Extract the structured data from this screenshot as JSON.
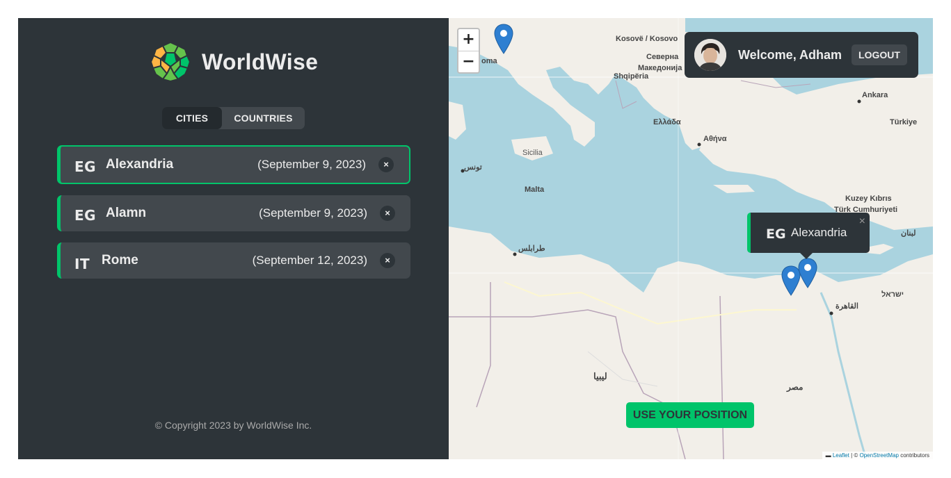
{
  "app": {
    "name": "WorldWise",
    "accent_color": "#00c46a",
    "panel_color": "#2d3439"
  },
  "tabs": [
    {
      "label": "CITIES",
      "active": true
    },
    {
      "label": "COUNTRIES",
      "active": false
    }
  ],
  "cities": [
    {
      "code": "EG",
      "name": "Alexandria",
      "date": "(September 9, 2023)",
      "delete_label": "×",
      "active": true
    },
    {
      "code": "EG",
      "name": "Alamn",
      "date": "(September 9, 2023)",
      "delete_label": "×",
      "active": false
    },
    {
      "code": "IT",
      "name": "Rome",
      "date": "(September 12, 2023)",
      "delete_label": "×",
      "active": false
    }
  ],
  "footer": {
    "copyright": "© Copyright 2023 by WorldWise Inc."
  },
  "map": {
    "zoom_in": "+",
    "zoom_out": "−",
    "user": {
      "welcome": "Welcome, Adham",
      "logout": "LOGOUT"
    },
    "popup": {
      "code": "EG",
      "name": "Alexandria",
      "close": "×"
    },
    "use_position": "USE YOUR POSITION",
    "attribution": {
      "leaflet": "Leaflet",
      "sep": " | © ",
      "osm": "OpenStreetMap",
      "suffix": " contributors"
    },
    "labels": [
      {
        "id": "kosovo",
        "text": "Kosovë / Kosovo"
      },
      {
        "id": "serbia",
        "text": "Северна"
      },
      {
        "id": "makedonia",
        "text": "Македонија"
      },
      {
        "id": "shqiperia",
        "text": "Shqipëria"
      },
      {
        "id": "roma",
        "text": "oma"
      },
      {
        "id": "ankara",
        "text": "Ankara"
      },
      {
        "id": "turkiye",
        "text": "Türkiye"
      },
      {
        "id": "ellada",
        "text": "Ελλάδα"
      },
      {
        "id": "athina",
        "text": "Αθήνα"
      },
      {
        "id": "malta",
        "text": "Malta"
      },
      {
        "id": "sicilia",
        "text": "Sicilia"
      },
      {
        "id": "tunis",
        "text": "تونس"
      },
      {
        "id": "tarablus",
        "text": "طرابلس"
      },
      {
        "id": "kibris",
        "text": "Kuzey Kıbrıs"
      },
      {
        "id": "turk",
        "text": "Türk Cumhuriyeti"
      },
      {
        "id": "lubnan",
        "text": "لبنان"
      },
      {
        "id": "cairo",
        "text": "القاهرة"
      },
      {
        "id": "israel",
        "text": "ישראל"
      },
      {
        "id": "libya",
        "text": "ليبيا"
      },
      {
        "id": "misr",
        "text": "مصر"
      }
    ]
  }
}
